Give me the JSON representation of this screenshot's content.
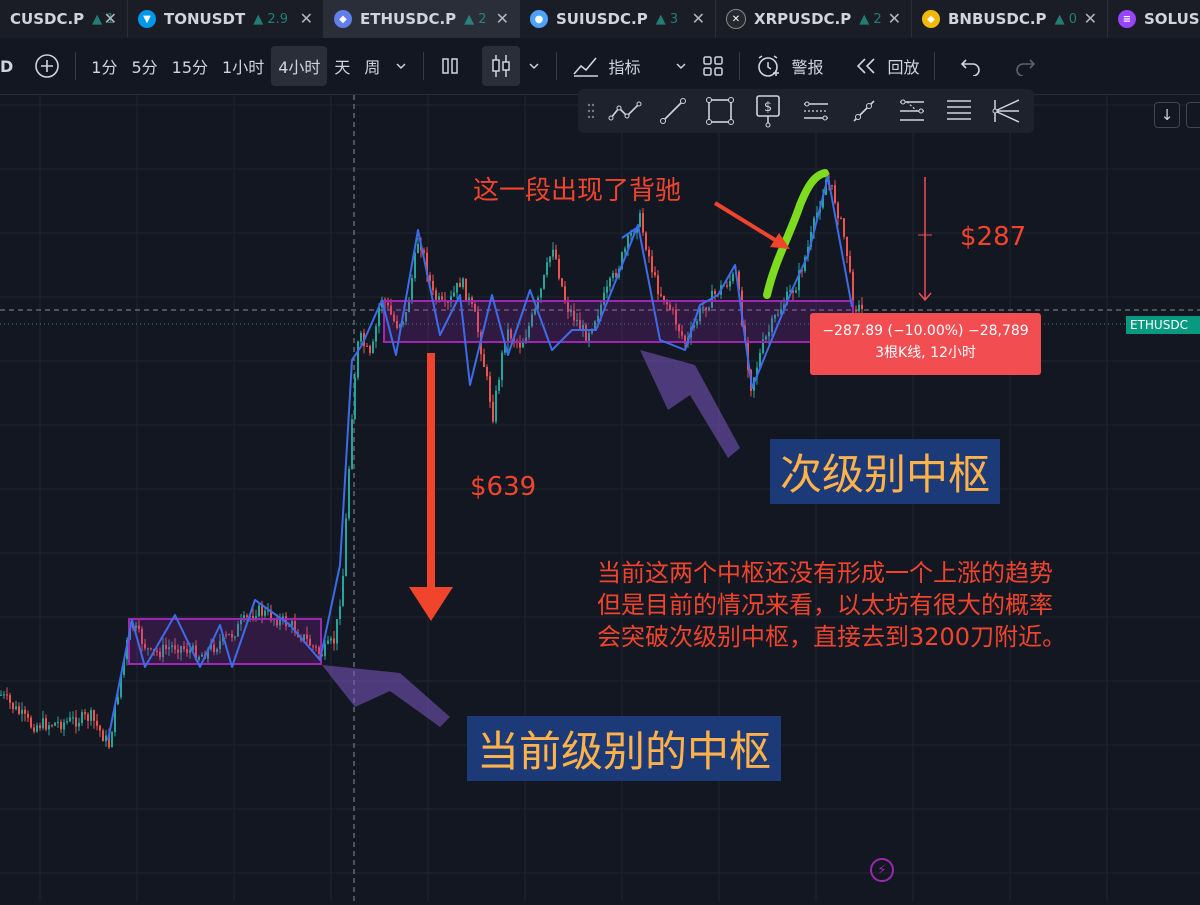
{
  "tabs": [
    {
      "symbol": "CUSDC.P",
      "change": "▲ 1",
      "icon_color": "#3b82f6",
      "active": false
    },
    {
      "symbol": "TONUSDT",
      "change": "▲ 2.9",
      "icon_color": "#0098ea",
      "active": false
    },
    {
      "symbol": "ETHUSDC.P",
      "change": "▲ 2",
      "icon_color": "#627eea",
      "active": true
    },
    {
      "symbol": "SUIUSDC.P",
      "change": "▲ 3",
      "icon_color": "#4da2ff",
      "active": false
    },
    {
      "symbol": "XRPUSDC.P",
      "change": "▲ 2",
      "icon_color": "#23292f",
      "active": false
    },
    {
      "symbol": "BNBUSDC.P",
      "change": "▲ 0",
      "icon_color": "#f0b90b",
      "active": false
    },
    {
      "symbol": "SOLUS",
      "change": "",
      "icon_color": "#9945ff",
      "active": false
    }
  ],
  "toolbar": {
    "d_label": "D",
    "add_icon": "plus-circle-icon",
    "intervals": [
      "1分",
      "5分",
      "15分",
      "1小时",
      "4小时",
      "天",
      "周"
    ],
    "active_interval": "4小时",
    "indicators_label": "指标",
    "alert_label": "警报",
    "replay_label": "回放"
  },
  "draw_tools": [
    "drag-handle-icon",
    "polyline-icon",
    "trendline-icon",
    "rectangle-icon",
    "price-label-icon",
    "parallel-channel-icon",
    "ray-icon",
    "fib-icon",
    "lines-icon",
    "pitchfork-icon"
  ],
  "chart": {
    "symbol_tag": "ETHUSDC",
    "annotation_divergence": "这一段出现了背驰",
    "amount_287": "$287",
    "amount_639": "$639",
    "label_sub_level": "次级别中枢",
    "label_current_level": "当前级别的中枢",
    "comment_line1": "当前这两个中枢还没有形成一个上涨的趋势",
    "comment_line2": "但是目前的情况来看，以太坊有很大的概率",
    "comment_line3": "会突破次级别中枢，直接去到3200刀附近。",
    "measure_line1": "−287.89 (−10.00%) −28,789",
    "measure_line2": "3根K线, 12小时",
    "colors": {
      "background": "#131722",
      "up": "#26a69a",
      "down": "#ef5350",
      "zigzag": "#3d6ce8",
      "box": "#9c27b0",
      "arrow": "#f0442c",
      "highlight": "#7ddc1f"
    }
  }
}
